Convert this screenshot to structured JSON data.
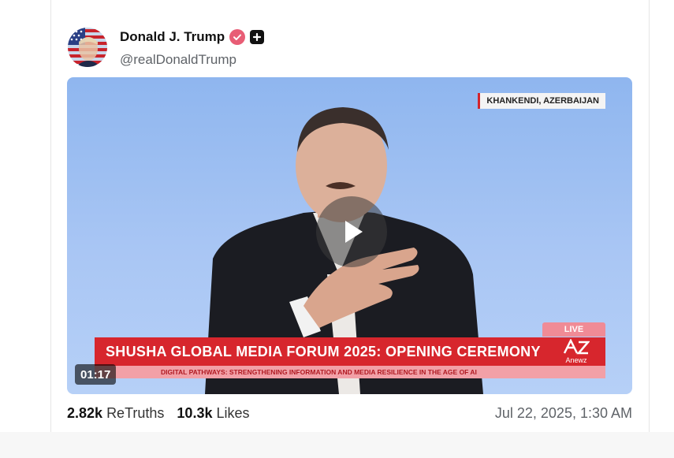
{
  "post": {
    "author": {
      "display_name": "Donald J. Trump",
      "handle": "@realDonaldTrump",
      "verified": true,
      "avatar_icon": "avatar-flag-portrait"
    },
    "video": {
      "location_tag": "KHANKENDI, AZERBAIJAN",
      "live_label": "LIVE",
      "headline": "SHUSHA GLOBAL MEDIA FORUM 2025: OPENING CEREMONY",
      "ticker": "DIGITAL PATHWAYS: STRENGTHENING INFORMATION AND MEDIA RESILIENCE IN THE AGE OF AI",
      "broadcaster": "Anewz",
      "duration": "01:17",
      "play_icon": "play-icon"
    },
    "stats": {
      "retruths_count": "2.82k",
      "retruths_label": "ReTruths",
      "likes_count": "10.3k",
      "likes_label": "Likes"
    },
    "timestamp": "Jul 22, 2025, 1:30 AM"
  },
  "colors": {
    "verified_badge": "#e85d75",
    "lower_third": "#d7262d",
    "video_background": "#a9c6f4"
  }
}
